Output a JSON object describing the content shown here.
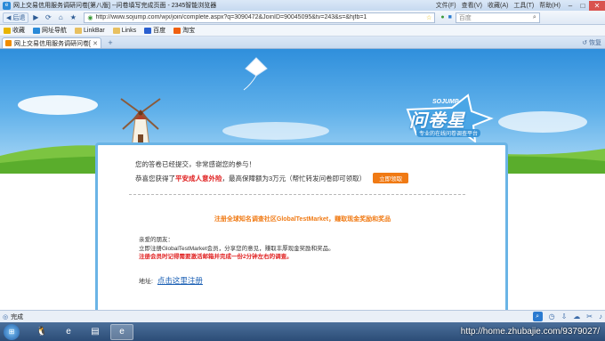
{
  "window": {
    "title": "网上交易信用服务调研问卷[第八版] --问卷填写完成页面 - 2345智能浏览器",
    "menus": [
      "文件(F)",
      "查看(V)",
      "收藏(A)",
      "工具(T)",
      "帮助(H)"
    ]
  },
  "nav": {
    "back_label": "后退",
    "url": "http://www.sojump.com/wjx/join/complete.aspx?q=3090472&JoinID=90045095&tv=243&s=&hjfb=1",
    "search_placeholder": "百度"
  },
  "favorites": {
    "items": [
      {
        "label": "收藏",
        "color": "#e8b400"
      },
      {
        "label": "网址导航",
        "color": "#2a8ad8"
      },
      {
        "label": "LinkBar",
        "color": "#e8c060"
      },
      {
        "label": "Links",
        "color": "#e8c060"
      },
      {
        "label": "百度",
        "color": "#2a5fd0"
      },
      {
        "label": "淘宝",
        "color": "#f06010"
      }
    ]
  },
  "tabs": [
    {
      "label": "网上交易信用服务调研问卷[第八..."
    }
  ],
  "tabbar": {
    "restore_label": "恢复"
  },
  "page": {
    "logo_small": "SOJUMP",
    "logo_brand": "问卷星",
    "logo_sub": "专业的在线问卷调查平台",
    "thanks": "您的答卷已经提交，非常感谢您的参与！",
    "gift_prefix": "恭喜您获得了",
    "gift_name": "平安成人意外险",
    "gift_suffix": "，最高保障额为3万元（帮忙转发问卷即可领取）",
    "claim_button": "立即领取",
    "headline": "注册全球知名调查社区GlobalTestMarket，赚取现金奖励和奖品",
    "friend": "亲爱的朋友：",
    "line2": "立即注册GlobalTestMarket会员，分享您的意见，赚取丰厚现金奖励和奖品。",
    "line3": "注册会员时记得需要激活邮箱并完成一份2分钟左右的调查。",
    "addr_label": "地址:",
    "addr_link": "点击这里注册"
  },
  "status": {
    "text": "完成"
  },
  "taskbar": {
    "watermark": "http://home.zhubajie.com/9379027/"
  }
}
